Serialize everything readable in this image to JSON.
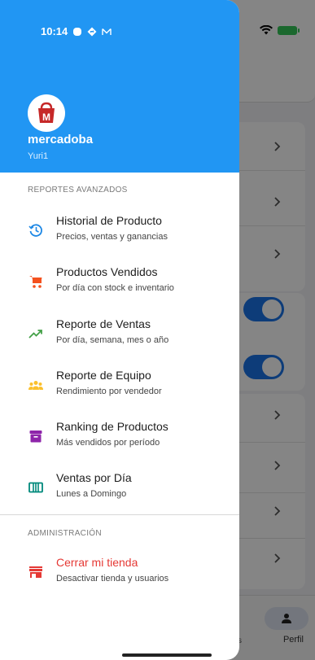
{
  "status_bar": {
    "time": "10:14"
  },
  "drawer": {
    "store_name": "mercadoba",
    "user_name": "Yuri1",
    "sections": [
      {
        "label": "REPORTES AVANZADOS",
        "items": [
          {
            "title": "Historial de Producto",
            "subtitle": "Precios, ventas y ganancias",
            "icon": "history-icon",
            "color": "#1e88e5"
          },
          {
            "title": "Productos Vendidos",
            "subtitle": "Por día con stock e inventario",
            "icon": "cart-icon",
            "color": "#f4511e"
          },
          {
            "title": "Reporte de Ventas",
            "subtitle": "Por día, semana, mes o año",
            "icon": "trending-up-icon",
            "color": "#43a047"
          },
          {
            "title": "Reporte de Equipo",
            "subtitle": "Rendimiento por vendedor",
            "icon": "team-icon",
            "color": "#fbc02d"
          },
          {
            "title": "Ranking de Productos",
            "subtitle": "Más vendidos por período",
            "icon": "archive-icon",
            "color": "#8e24aa"
          },
          {
            "title": "Ventas por Día",
            "subtitle": "Lunes a Domingo",
            "icon": "calendar-columns-icon",
            "color": "#00897b"
          }
        ]
      },
      {
        "label": "ADMINISTRACIÓN",
        "items": [
          {
            "title": "Cerrar mi tienda",
            "subtitle": "Desactivar tienda y usuarios",
            "icon": "store-closed-icon",
            "color": "#e53935"
          }
        ]
      }
    ]
  },
  "background": {
    "tabbar": {
      "profile_label": "Perfil",
      "partial_label": "s"
    }
  },
  "colors": {
    "header_blue": "#2196f3",
    "danger": "#e53935",
    "toggle_blue": "#1a73e8"
  }
}
